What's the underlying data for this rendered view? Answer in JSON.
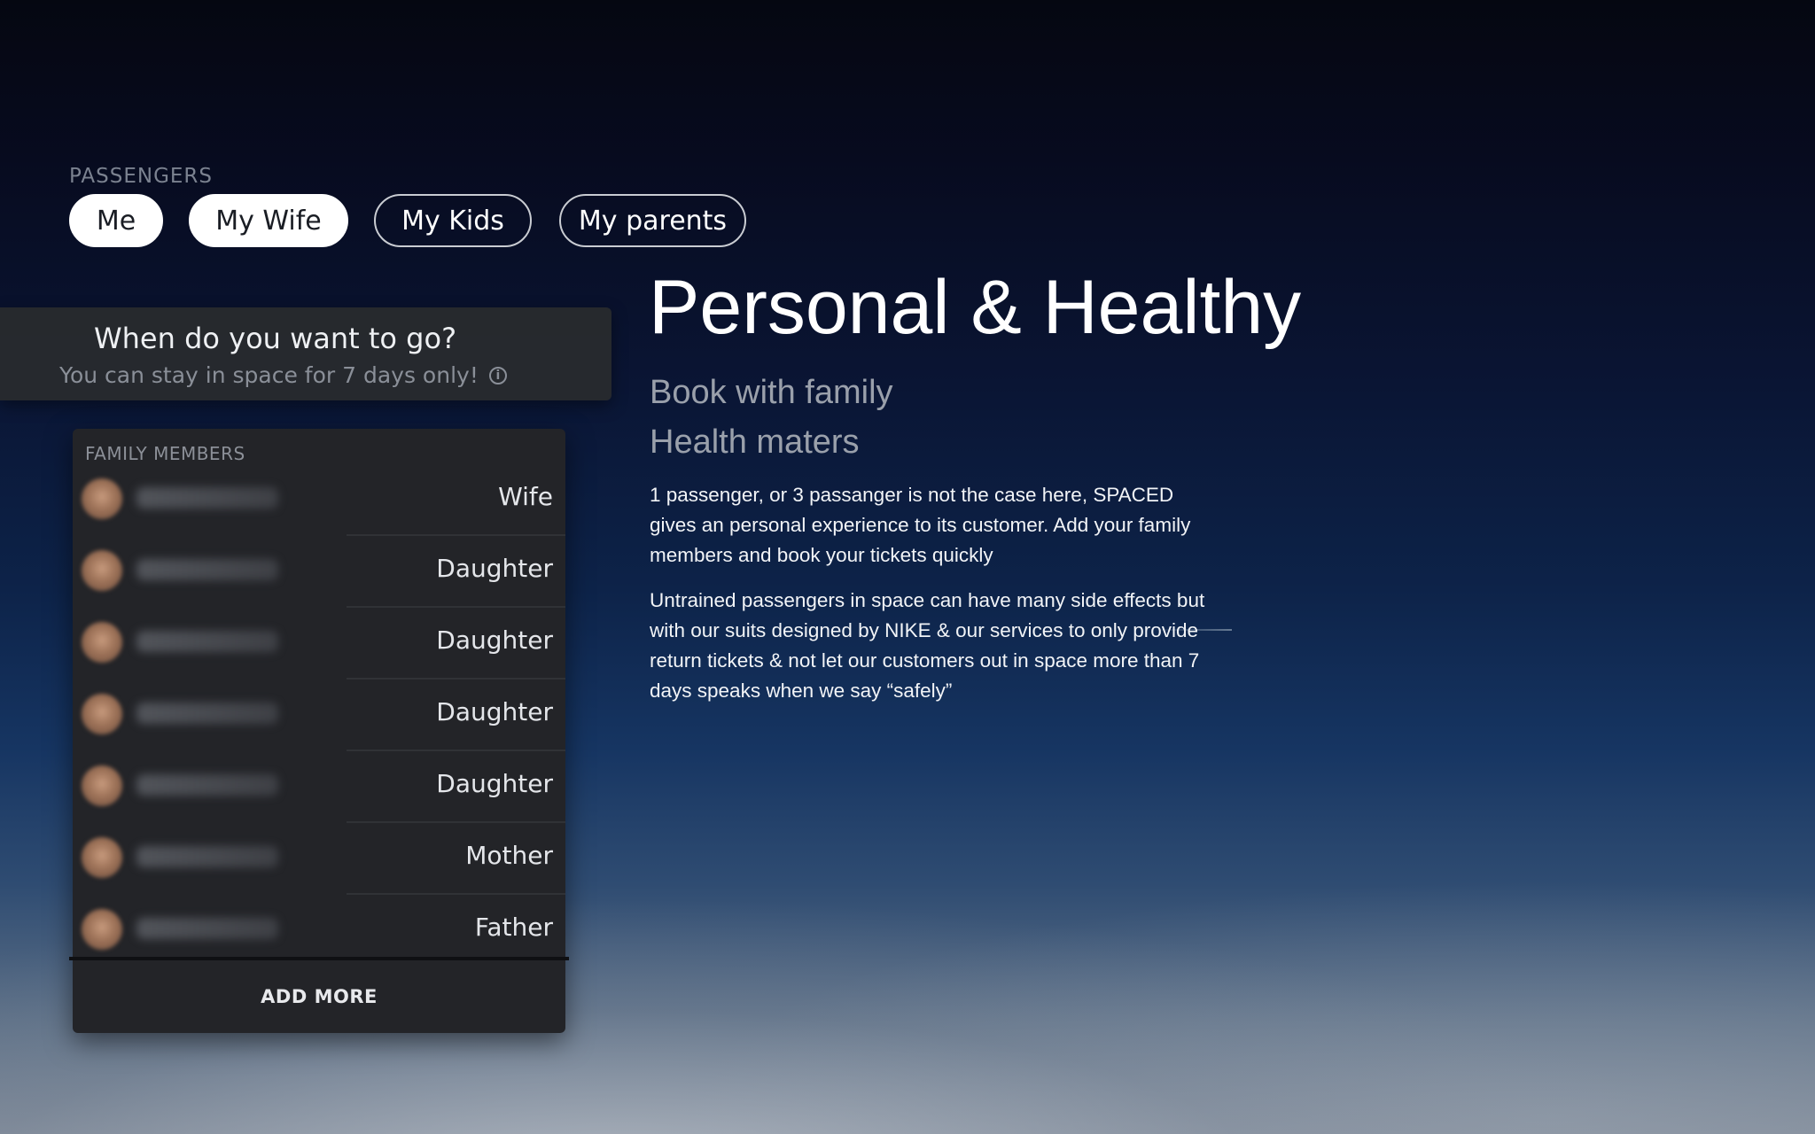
{
  "passengers": {
    "label": "PASSENGERS",
    "options": [
      {
        "label": "Me",
        "selected": true
      },
      {
        "label": "My Wife",
        "selected": true
      },
      {
        "label": "My Kids",
        "selected": false
      },
      {
        "label": "My parents",
        "selected": false
      }
    ]
  },
  "when": {
    "title": "When do you want to go?",
    "subtitle": "You can stay in space for 7 days only!",
    "info_icon": "info-icon"
  },
  "family": {
    "label": "FAMILY MEMBERS",
    "members": [
      {
        "relation": "Wife"
      },
      {
        "relation": "Daughter"
      },
      {
        "relation": "Daughter"
      },
      {
        "relation": "Daughter"
      },
      {
        "relation": "Daughter"
      },
      {
        "relation": "Mother"
      },
      {
        "relation": "Father"
      }
    ],
    "add_more": "ADD MORE"
  },
  "content": {
    "headline": "Personal & Healthy",
    "subheadline_1": "Book with family",
    "subheadline_2": "Health maters",
    "paragraph_1": "1 passenger, or 3 passanger is not the case here, SPACED gives an personal experience to its customer. Add your family members and book your tickets quickly",
    "paragraph_2": "Untrained passengers in space can have many side effects but with our suits designed by NIKE & our services to only provide return tickets & not let our customers out in space more than 7 days speaks when we say “safely”"
  },
  "colors": {
    "pill_selected_bg": "#ffffff",
    "panel_bg": "#232428",
    "muted_text": "#9aa0ab"
  }
}
